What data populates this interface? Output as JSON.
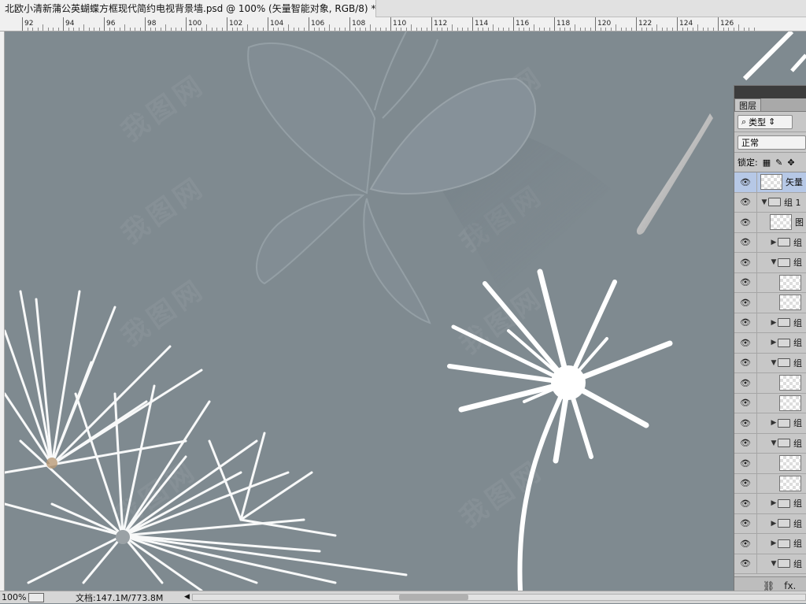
{
  "document": {
    "tab_title": "北欧小清新蒲公英蝴蝶方框现代简约电视背景墙.psd @ 100% (矢量智能对象, RGB/8) *"
  },
  "ruler": {
    "labels": [
      "92",
      "94",
      "96",
      "98",
      "100",
      "102",
      "104",
      "106",
      "108",
      "110",
      "112",
      "114",
      "116",
      "118",
      "120",
      "122",
      "124",
      "126"
    ]
  },
  "canvas": {
    "background": "#7f8a90",
    "watermark_text": "我图网"
  },
  "layers_panel": {
    "tab_label": "图层",
    "filter_label": "类型",
    "blend_mode": "正常",
    "lock_label": "锁定:",
    "layers": [
      {
        "name": "矢量",
        "type": "smart",
        "selected": true,
        "indent": 0
      },
      {
        "name": "组 1",
        "type": "group-open",
        "indent": 0
      },
      {
        "name": "图",
        "type": "layer",
        "indent": 1
      },
      {
        "name": "组",
        "type": "group-closed",
        "indent": 1
      },
      {
        "name": "组",
        "type": "group-open",
        "indent": 1
      },
      {
        "name": "",
        "type": "layer",
        "indent": 2
      },
      {
        "name": "",
        "type": "layer",
        "indent": 2
      },
      {
        "name": "组",
        "type": "group-closed",
        "indent": 1
      },
      {
        "name": "组",
        "type": "group-closed",
        "indent": 1
      },
      {
        "name": "组",
        "type": "group-open",
        "indent": 1
      },
      {
        "name": "",
        "type": "layer",
        "indent": 2
      },
      {
        "name": "",
        "type": "layer",
        "indent": 2
      },
      {
        "name": "组",
        "type": "group-closed",
        "indent": 1
      },
      {
        "name": "组",
        "type": "group-open",
        "indent": 1
      },
      {
        "name": "",
        "type": "layer",
        "indent": 2
      },
      {
        "name": "",
        "type": "layer",
        "indent": 2
      },
      {
        "name": "组",
        "type": "group-closed",
        "indent": 1
      },
      {
        "name": "组",
        "type": "group-closed",
        "indent": 1
      },
      {
        "name": "组",
        "type": "group-closed",
        "indent": 1
      },
      {
        "name": "组",
        "type": "group-open",
        "indent": 1
      }
    ],
    "footer_icons": [
      "link-icon",
      "fx-icon",
      "mask-icon"
    ],
    "footer_fx": "fx."
  },
  "status": {
    "zoom": "100%",
    "doc_label": "文档:147.1M/773.8M"
  }
}
